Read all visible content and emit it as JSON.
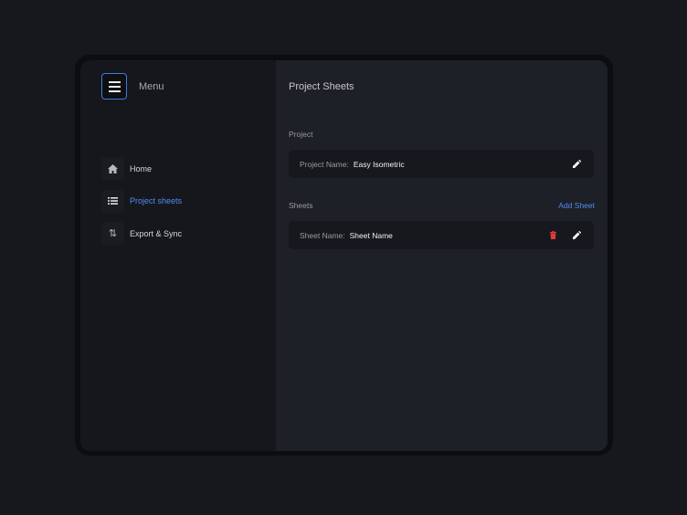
{
  "sidebar": {
    "menu_label": "Menu",
    "items": [
      {
        "label": "Home",
        "icon": "home-icon"
      },
      {
        "label": "Project sheets",
        "icon": "list-icon",
        "active": true
      },
      {
        "label": "Export & Sync",
        "icon": "sort-arrows-icon"
      }
    ]
  },
  "main": {
    "title": "Project Sheets",
    "project": {
      "section": "Project",
      "key": "Project Name:",
      "value": "Easy Isometric"
    },
    "sheets": {
      "section": "Sheets",
      "add_label": "Add Sheet",
      "rows": [
        {
          "key": "Sheet Name:",
          "value": "Sheet Name"
        }
      ]
    }
  },
  "colors": {
    "accent": "#4f8cf0",
    "danger": "#e03a3a"
  }
}
